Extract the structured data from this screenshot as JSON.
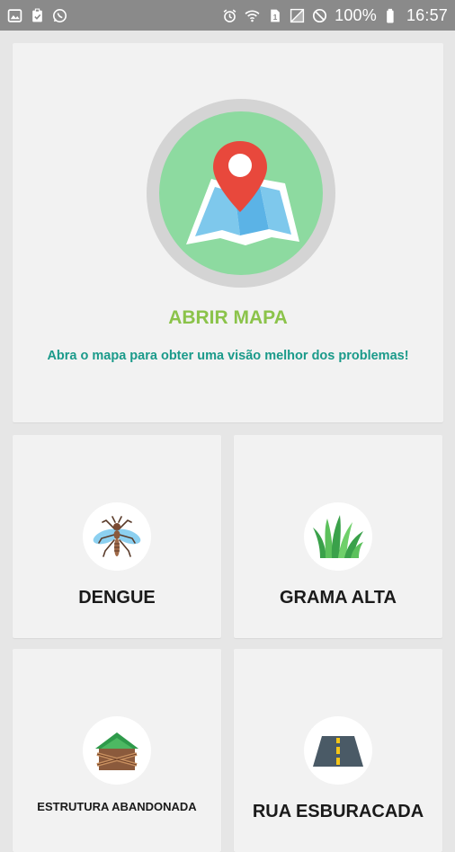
{
  "statusbar": {
    "battery": "100%",
    "time": "16:57"
  },
  "map_card": {
    "title": "ABRIR MAPA",
    "subtitle": "Abra o mapa para obter uma visão melhor dos problemas!",
    "icon": "map-pin-icon"
  },
  "categories": [
    {
      "label": "DENGUE",
      "icon": "mosquito-icon"
    },
    {
      "label": "GRAMA ALTA",
      "icon": "grass-icon"
    },
    {
      "label": "ESTRUTURA ABANDONADA",
      "icon": "abandoned-structure-icon"
    },
    {
      "label": "RUA ESBURACADA",
      "icon": "road-icon"
    }
  ],
  "colors": {
    "accent_green": "#8bc34a",
    "teal": "#1a9a8a",
    "statusbar": "#8a8a8a"
  }
}
